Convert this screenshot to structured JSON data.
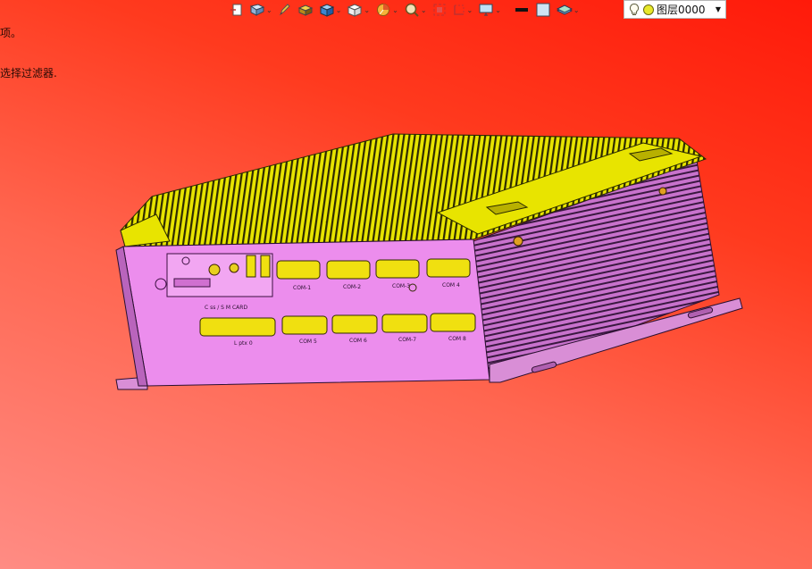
{
  "prompt": {
    "line1": "项。",
    "line2": "选择过滤器."
  },
  "toolbar": {
    "items": [
      {
        "icon": "sketch-rect-icon"
      },
      {
        "icon": "view-orientation-icon"
      },
      {
        "icon": "pencil-icon"
      },
      {
        "icon": "shaded-box-icon"
      },
      {
        "icon": "view-box-icon"
      },
      {
        "icon": "white-cube-icon"
      },
      {
        "icon": "pie-section-icon"
      },
      {
        "icon": "magnifier-icon"
      },
      {
        "icon": "fit-view-icon"
      },
      {
        "icon": "clip-view-icon"
      },
      {
        "icon": "display-monitor-icon"
      },
      {
        "icon": "line-color-icon"
      },
      {
        "icon": "background-color-icon"
      },
      {
        "icon": "layer-stack-icon"
      }
    ],
    "layer_select": {
      "value": "图层0000"
    }
  },
  "model": {
    "front_labels": {
      "card_slot": "C ss / S M CARD",
      "top_ports": [
        "COM-1",
        "COM-2",
        "COM-3",
        "COM 4"
      ],
      "bottom_ports": [
        "L ptx 0",
        "COM 5",
        "COM 6",
        "COM-7",
        "COM 8"
      ]
    }
  },
  "colors": {
    "background_top": "#ff1a0a",
    "background_bottom": "#ff8c84",
    "body_panel": "#ec8ded",
    "heatsink": "#e8e400",
    "connectors": "#f0e010"
  }
}
